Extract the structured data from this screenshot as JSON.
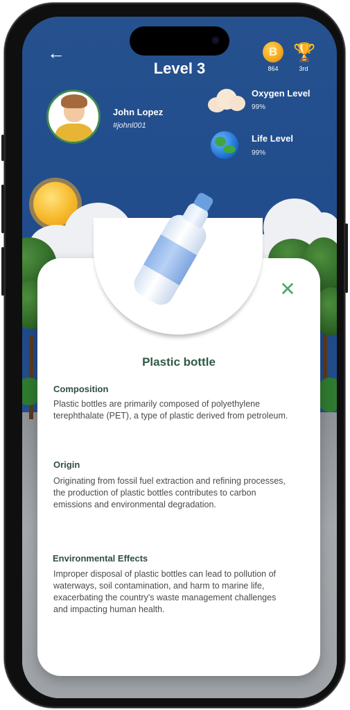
{
  "header": {
    "level_title": "Level 3",
    "coins": "864",
    "rank": "3rd",
    "coin_glyph": "B"
  },
  "user": {
    "name": "John Lopez",
    "handle": "#johnl001"
  },
  "meters": {
    "oxygen_label": "Oxygen Level",
    "oxygen_value": "99%",
    "life_label": "Life Level",
    "life_value": "99%"
  },
  "card": {
    "title": "Plastic bottle",
    "sections": [
      {
        "heading": "Composition",
        "body": "Plastic bottles are primarily composed of polyethylene terephthalate (PET), a type of plastic derived from petroleum."
      },
      {
        "heading": "Origin",
        "body": "Originating from fossil fuel extraction and refining processes, the production of plastic bottles contributes to carbon emissions and environmental degradation."
      },
      {
        "heading": "Environmental Effects",
        "body": "Improper disposal of plastic bottles can lead to pollution of waterways, soil contamination, and harm to marine life, exacerbating the country's waste management challenges and impacting human health."
      }
    ]
  },
  "icons": {
    "back": "back-arrow-icon",
    "coin": "coin-icon",
    "trophy": "trophy-icon",
    "cloud": "cloud-icon",
    "globe": "globe-icon",
    "close": "close-icon"
  },
  "colors": {
    "sky": "#234e8f",
    "accent_green": "#4fa66e",
    "title_green": "#2f5a44"
  }
}
